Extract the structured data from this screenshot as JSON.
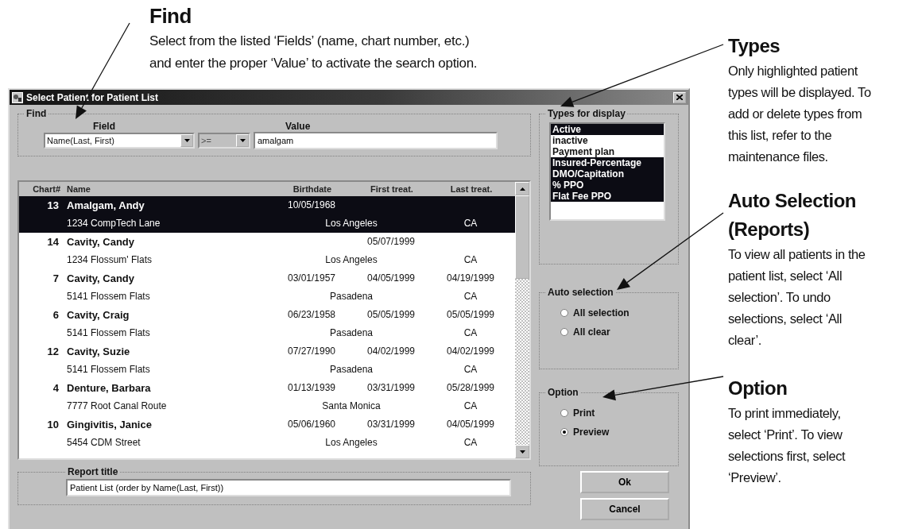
{
  "find_callout": {
    "title": "Find",
    "lines": [
      "Select from the listed ‘Fields’ (name, chart number, etc.)",
      "and enter the proper ‘Value’ to activate the search option."
    ]
  },
  "dialog": {
    "title": "Select Patient for Patient List",
    "find": {
      "label": "Find",
      "field_label": "Field",
      "value_label": "Value",
      "field": "Name(Last, First)",
      "operator": {
        "text": ">=",
        "disabled": true
      },
      "value": "amalgam"
    },
    "table": {
      "columns": [
        "Chart#",
        "Name",
        "Birthdate",
        "First treat.",
        "Last treat."
      ],
      "rows": [
        {
          "chart": "13",
          "name": "Amalgam, Andy",
          "birthdate": "10/05/1968",
          "address": "1234 CompTech Lane",
          "city": "Los Angeles",
          "state": "CA",
          "selected": true
        },
        {
          "chart": "14",
          "name": "Cavity, Candy",
          "first_treat": "05/07/1999",
          "address": "1234 Flossum' Flats",
          "city": "Los Angeles",
          "state": "CA",
          "selected": false
        },
        {
          "chart": "7",
          "name": "Cavity, Candy",
          "birthdate": "03/01/1957",
          "first_treat": "04/05/1999",
          "last_treat": "04/19/1999",
          "address": "5141 Flossem Flats",
          "city": "Pasadena",
          "state": "CA",
          "selected": false
        },
        {
          "chart": "6",
          "name": "Cavity, Craig",
          "birthdate": "06/23/1958",
          "first_treat": "05/05/1999",
          "last_treat": "05/05/1999",
          "address": "5141 Flossem Flats",
          "city": "Pasadena",
          "state": "CA",
          "selected": false
        },
        {
          "chart": "12",
          "name": "Cavity, Suzie",
          "birthdate": "07/27/1990",
          "first_treat": "04/02/1999",
          "last_treat": "04/02/1999",
          "address": "5141 Flossem Flats",
          "city": "Pasadena",
          "state": "CA",
          "selected": false
        },
        {
          "chart": "4",
          "name": "Denture, Barbara",
          "birthdate": "01/13/1939",
          "first_treat": "03/31/1999",
          "last_treat": "05/28/1999",
          "address": "7777 Root Canal Route",
          "city": "Santa Monica",
          "state": "CA",
          "selected": false
        },
        {
          "chart": "10",
          "name": "Gingivitis, Janice",
          "birthdate": "05/06/1960",
          "first_treat": "03/31/1999",
          "last_treat": "04/05/1999",
          "address": "5454 CDM Street",
          "city": "Los Angeles",
          "state": "CA",
          "selected": false
        }
      ]
    },
    "report_title": {
      "label": "Report title",
      "value": "Patient List (order by Name(Last, First))"
    },
    "types": {
      "label": "Types for display",
      "items": [
        {
          "label": "Active",
          "selected": true
        },
        {
          "label": "inactive",
          "selected": false
        },
        {
          "label": "Payment plan",
          "selected": false
        },
        {
          "label": "Insured-Percentage",
          "selected": true
        },
        {
          "label": "DMO/Capitation",
          "selected": true
        },
        {
          "label": "% PPO",
          "selected": true
        },
        {
          "label": "Flat Fee PPO",
          "selected": true
        }
      ]
    },
    "auto_selection": {
      "label": "Auto selection",
      "options": [
        {
          "label": "All selection",
          "selected": false
        },
        {
          "label": "All clear",
          "selected": false
        }
      ]
    },
    "option": {
      "label": "Option",
      "options": [
        {
          "label": "Print",
          "selected": false
        },
        {
          "label": "Preview",
          "selected": true
        }
      ]
    },
    "buttons": [
      "Ok",
      "Cancel"
    ]
  },
  "side_callouts": [
    {
      "title": "Types",
      "lines": [
        "Only highlighted patient",
        "types will be displayed. To",
        "add or delete types from",
        "this list, refer to the",
        "maintenance files."
      ]
    },
    {
      "title": "Auto Selection (Reports)",
      "lines": [
        "To view all patients in the",
        "patient list, select ‘All",
        "selection’.  To undo",
        "selections, select ‘All",
        "clear’."
      ]
    },
    {
      "title": "Option",
      "lines": [
        "To print immediately,",
        "select ‘Print’.  To view",
        "selections first, select",
        "‘Preview’."
      ]
    }
  ]
}
